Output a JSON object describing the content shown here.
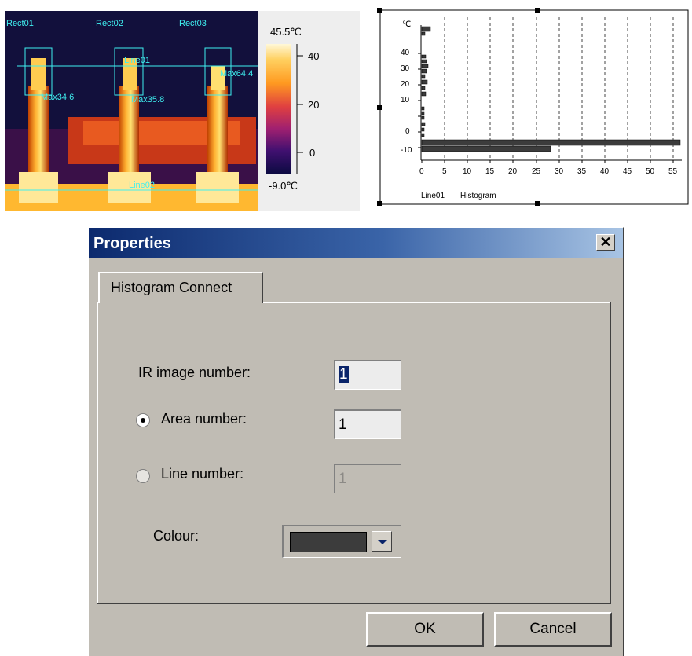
{
  "thermal": {
    "scale_max": "45.5℃",
    "scale_min": "-9.0℃",
    "scale_ticks": [
      "40",
      "20",
      "0"
    ],
    "labels": {
      "rect1": "Rect01",
      "rect2": "Rect02",
      "rect3": "Rect03",
      "line1": "Line01",
      "line2": "Line02",
      "max1": "Max34.6",
      "max2": "Max35.8",
      "max3": "Max64.4"
    },
    "overlay_color": "#3ff0f0"
  },
  "histogram": {
    "unit": "℃",
    "caption_line": "Line01",
    "caption_word": "Histogram",
    "y_ticks": [
      "40",
      "30",
      "20",
      "10",
      "0",
      "-10"
    ],
    "x_ticks": [
      "0",
      "5",
      "10",
      "15",
      "20",
      "25",
      "30",
      "35",
      "40",
      "45",
      "50",
      "55"
    ],
    "bar_color": "#3c3c3c"
  },
  "dialog": {
    "title": "Properties",
    "close_glyph": "✕",
    "tab": "Histogram Connect",
    "ir_label": "IR image number:",
    "ir_value": "1",
    "area_label": "Area number:",
    "area_value": "1",
    "line_label": "Line number:",
    "line_value": "1",
    "colour_label": "Colour:",
    "colour_value": "#3c3c3c",
    "ok": "OK",
    "cancel": "Cancel"
  }
}
